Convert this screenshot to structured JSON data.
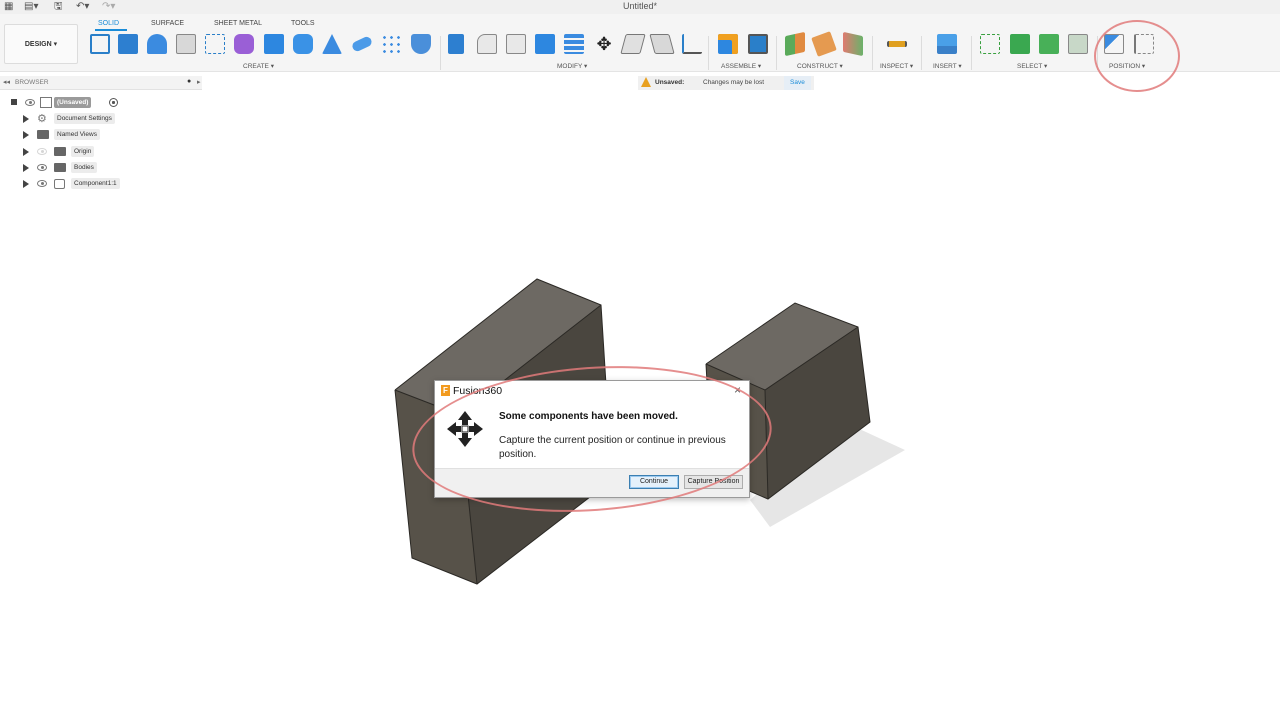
{
  "window": {
    "title": "Untitled*"
  },
  "toolbar": {
    "workspace_button": "DESIGN ▾",
    "tabs": [
      "SOLID",
      "SURFACE",
      "SHEET METAL",
      "TOOLS"
    ],
    "groups": {
      "create": "CREATE ▾",
      "modify": "MODIFY ▾",
      "assemble": "ASSEMBLE ▾",
      "construct": "CONSTRUCT ▾",
      "inspect": "INSPECT ▾",
      "insert": "INSERT ▾",
      "select": "SELECT ▾",
      "position": "POSITION ▾"
    }
  },
  "browser": {
    "header": "BROWSER",
    "root": "(Unsaved)",
    "items": [
      "Document Settings",
      "Named Views",
      "Origin",
      "Bodies",
      "Component1:1"
    ]
  },
  "status": {
    "label": "Unsaved:",
    "message": "Changes may be lost",
    "save": "Save"
  },
  "dialog": {
    "title": "Fusion360",
    "heading": "Some components have been moved.",
    "message": "Capture the current position or continue in previous position.",
    "continue_button": "Continue",
    "capture_button": "Capture Position",
    "close_glyph": "×",
    "app_glyph": "F"
  },
  "colors": {
    "accent": "#1a8cd8",
    "annotation": "#e07a7a",
    "body_top": "#6d6963",
    "body_front": "#575249",
    "body_side": "#4a463f"
  },
  "icons": {
    "move": "move-arrows-icon",
    "warning": "warning-icon"
  }
}
